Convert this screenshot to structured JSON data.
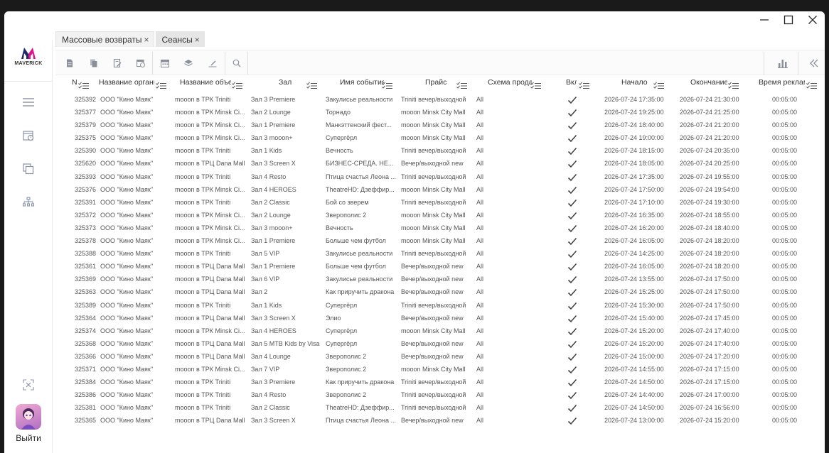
{
  "tabs": [
    {
      "label": "Массовые возвраты",
      "close": "×",
      "active": false
    },
    {
      "label": "Сеансы",
      "close": "×",
      "active": true
    }
  ],
  "brand": {
    "name": "MAVERICK",
    "accent": "#d9168a",
    "accent2": "#1f2a6b"
  },
  "sidebar": {
    "icons": [
      "menu-icon",
      "calendar-clock-icon",
      "copy-icon",
      "network-icon",
      "shuffle-x-icon"
    ],
    "logout_label": "Выйти"
  },
  "toolbar": {
    "icons": [
      "document-icon",
      "copy-document-icon",
      "edit-document-icon",
      "schedule-icon",
      "calendar-icon",
      "layers-icon",
      "sign-icon",
      "search-icon",
      "bar-chart-icon",
      "collapse-icon"
    ]
  },
  "table": {
    "columns": [
      "N",
      "Название органи",
      "Название объе",
      "Зал",
      "Имя события",
      "Прайс",
      "Схема прода",
      "Вкл",
      "Начало",
      "Окончание",
      "Время реклам"
    ],
    "rows": [
      [
        "325392",
        "ООО \"Кино Маяк\"",
        "mooon в ТРК Triniti",
        "Зал 3 Premiere",
        "Закулисье реальности",
        "Triniti вечер/выходной",
        "All",
        "2026-07-24 17:35:00",
        "2026-07-24 21:30:00",
        "00:05:00"
      ],
      [
        "325377",
        "ООО \"Кино Маяк\"",
        "mooon в ТРК Minsk Ci...",
        "Зал 2 Lounge",
        "Торнадо",
        "mooon Minsk City Mall",
        "All",
        "2026-07-24 19:25:00",
        "2026-07-24 21:25:00",
        "00:05:00"
      ],
      [
        "325379",
        "ООО \"Кино Маяк\"",
        "mooon в ТРК Minsk Ci...",
        "Зал 1 Premiere",
        "Манкэттенский фест...",
        "mooon Minsk City Mall",
        "All",
        "2026-07-24 18:40:00",
        "2026-07-24 21:20:00",
        "00:05:00"
      ],
      [
        "325375",
        "ООО \"Кино Маяк\"",
        "mooon в ТРК Minsk Ci...",
        "Зал 3 mooon+",
        "Супергёрл",
        "mooon Minsk City Mall",
        "All",
        "2026-07-24 19:00:00",
        "2026-07-24 21:20:00",
        "00:05:00"
      ],
      [
        "325390",
        "ООО \"Кино Маяк\"",
        "mooon в ТРК Triniti",
        "Зал 1 Kids",
        "Вечность",
        "Triniti вечер/выходной",
        "All",
        "2026-07-24 18:15:00",
        "2026-07-24 20:35:00",
        "00:05:00"
      ],
      [
        "325620",
        "ООО \"Кино Маяк\"",
        "mooon в ТРЦ Dana Mall",
        "Зал 3 Screen X",
        "БИЗНЕС-СРЕДА. НЕ...",
        "Вечер/выходной new",
        "All",
        "2026-07-24 18:05:00",
        "2026-07-24 20:25:00",
        "00:05:00"
      ],
      [
        "325393",
        "ООО \"Кино Маяк\"",
        "mooon в ТРК Triniti",
        "Зал 4 Resto",
        "Птица счастья Леона ...",
        "Triniti вечер/выходной",
        "All",
        "2026-07-24 17:35:00",
        "2026-07-24 19:55:00",
        "00:05:00"
      ],
      [
        "325376",
        "ООО \"Кино Маяк\"",
        "mooon в ТРК Minsk Ci...",
        "Зал 4 HEROES",
        "TheatreHD: Дзеффир...",
        "mooon Minsk City Mall",
        "All",
        "2026-07-24 17:50:00",
        "2026-07-24 19:54:00",
        "00:05:00"
      ],
      [
        "325391",
        "ООО \"Кино Маяк\"",
        "mooon в ТРК Triniti",
        "Зал 2 Classic",
        "Бой со зверем",
        "Triniti вечер/выходной",
        "All",
        "2026-07-24 17:10:00",
        "2026-07-24 19:30:00",
        "00:05:00"
      ],
      [
        "325372",
        "ООО \"Кино Маяк\"",
        "mooon в ТРК Minsk Ci...",
        "Зал 2 Lounge",
        "Зверополис 2",
        "mooon Minsk City Mall",
        "All",
        "2026-07-24 16:35:00",
        "2026-07-24 18:55:00",
        "00:05:00"
      ],
      [
        "325373",
        "ООО \"Кино Маяк\"",
        "mooon в ТРК Minsk Ci...",
        "Зал 3 mooon+",
        "Вечность",
        "mooon Minsk City Mall",
        "All",
        "2026-07-24 16:20:00",
        "2026-07-24 18:40:00",
        "00:05:00"
      ],
      [
        "325378",
        "ООО \"Кино Маяк\"",
        "mooon в ТРК Minsk Ci...",
        "Зал 1 Premiere",
        "Больше чем футбол",
        "mooon Minsk City Mall",
        "All",
        "2026-07-24 16:05:00",
        "2026-07-24 18:20:00",
        "00:05:00"
      ],
      [
        "325388",
        "ООО \"Кино Маяк\"",
        "mooon в ТРК Triniti",
        "Зал 5 VIP",
        "Закулисье реальности",
        "Triniti вечер/выходной",
        "All",
        "2026-07-24 14:25:00",
        "2026-07-24 18:20:00",
        "00:05:00"
      ],
      [
        "325361",
        "ООО \"Кино Маяк\"",
        "mooon в ТРЦ Dana Mall",
        "Зал 1 Premiere",
        "Больше чем футбол",
        "Вечер/выходной new",
        "All",
        "2026-07-24 16:05:00",
        "2026-07-24 18:20:00",
        "00:05:00"
      ],
      [
        "325369",
        "ООО \"Кино Маяк\"",
        "mooon в ТРЦ Dana Mall",
        "Зал 6 VIP",
        "Закулисье реальности",
        "Вечер/выходной new",
        "All",
        "2026-07-24 13:55:00",
        "2026-07-24 17:50:00",
        "00:05:00"
      ],
      [
        "325363",
        "ООО \"Кино Маяк\"",
        "mooon в ТРЦ Dana Mall",
        "Зал 2",
        "Как приручить дракона",
        "Вечер/выходной new",
        "All",
        "2026-07-24 15:25:00",
        "2026-07-24 17:50:00",
        "00:05:00"
      ],
      [
        "325389",
        "ООО \"Кино Маяк\"",
        "mooon в ТРК Triniti",
        "Зал 1 Kids",
        "Супергёрл",
        "Triniti вечер/выходной",
        "All",
        "2026-07-24 15:30:00",
        "2026-07-24 17:50:00",
        "00:05:00"
      ],
      [
        "325364",
        "ООО \"Кино Маяк\"",
        "mooon в ТРЦ Dana Mall",
        "Зал 3 Screen X",
        "Элио",
        "Вечер/выходной new",
        "All",
        "2026-07-24 15:40:00",
        "2026-07-24 17:45:00",
        "00:05:00"
      ],
      [
        "325374",
        "ООО \"Кино Маяк\"",
        "mooon в ТРК Minsk Ci...",
        "Зал 4 HEROES",
        "Супергёрл",
        "mooon Minsk City Mall",
        "All",
        "2026-07-24 15:20:00",
        "2026-07-24 17:40:00",
        "00:05:00"
      ],
      [
        "325368",
        "ООО \"Кино Маяк\"",
        "mooon в ТРЦ Dana Mall",
        "Зал 5 MTB Kids by Visa",
        "Супергёрл",
        "Вечер/выходной new",
        "All",
        "2026-07-24 15:20:00",
        "2026-07-24 17:40:00",
        "00:05:00"
      ],
      [
        "325366",
        "ООО \"Кино Маяк\"",
        "mooon в ТРЦ Dana Mall",
        "Зал 4 Lounge",
        "Зверополис 2",
        "Вечер/выходной new",
        "All",
        "2026-07-24 15:00:00",
        "2026-07-24 17:20:00",
        "00:05:00"
      ],
      [
        "325371",
        "ООО \"Кино Маяк\"",
        "mooon в ТРК Minsk Ci...",
        "Зал 7 VIP",
        "Зверополис 2",
        "mooon Minsk City Mall",
        "All",
        "2026-07-24 14:55:00",
        "2026-07-24 17:15:00",
        "00:05:00"
      ],
      [
        "325384",
        "ООО \"Кино Маяк\"",
        "mooon в ТРК Triniti",
        "Зал 3 Premiere",
        "Как приручить дракона",
        "Triniti вечер/выходной",
        "All",
        "2026-07-24 14:50:00",
        "2026-07-24 17:15:00",
        "00:05:00"
      ],
      [
        "325386",
        "ООО \"Кино Маяк\"",
        "mooon в ТРК Triniti",
        "Зал 4 Resto",
        "Зверополис 2",
        "Triniti вечер/выходной",
        "All",
        "2026-07-24 14:40:00",
        "2026-07-24 17:00:00",
        "00:05:00"
      ],
      [
        "325381",
        "ООО \"Кино Маяк\"",
        "mooon в ТРК Triniti",
        "Зал 2 Classic",
        "TheatreHD: Дзеффир...",
        "Triniti вечер/выходной",
        "All",
        "2026-07-24 14:50:00",
        "2026-07-24 16:56:00",
        "00:05:00"
      ],
      [
        "325365",
        "ООО \"Кино Маяк\"",
        "mooon в ТРЦ Dana Mall",
        "Зал 3 Screen X",
        "Птица счастья Леона ...",
        "Вечер/выходной new",
        "All",
        "2026-07-24 13:00:00",
        "2026-07-24 15:20:00",
        "00:05:00"
      ]
    ]
  }
}
